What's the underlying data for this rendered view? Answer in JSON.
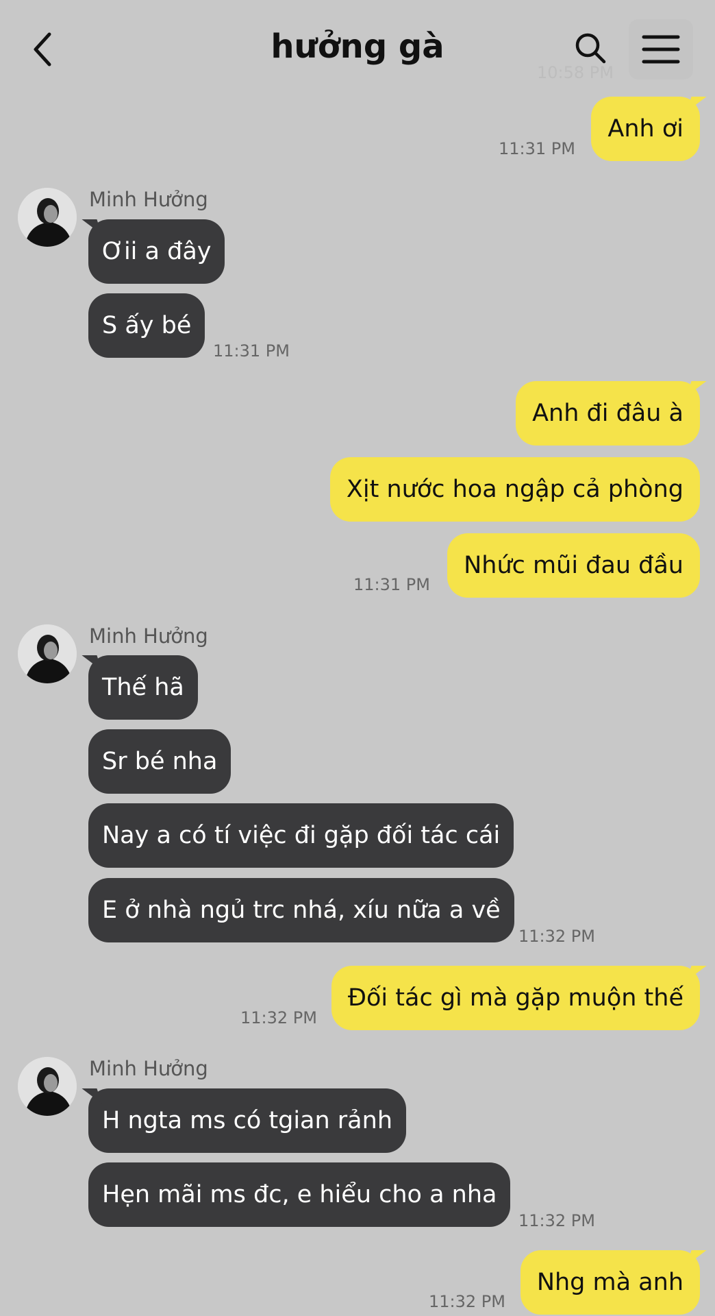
{
  "header": {
    "title": "hưởng gà",
    "ghost_time": "10:58 PM"
  },
  "contact": {
    "name": "Minh Hưởng"
  },
  "messages": [
    {
      "text": "Anh ơi",
      "time": "11:31 PM"
    },
    {
      "sender": "Minh Hưởng",
      "text": "Ơii a đây"
    },
    {
      "text": "S ấy bé",
      "time": "11:31 PM"
    },
    {
      "text": "Anh đi đâu à"
    },
    {
      "text": "Xịt nước hoa ngập cả phòng"
    },
    {
      "text": "Nhức mũi đau đầu",
      "time": "11:31 PM"
    },
    {
      "sender": "Minh Hưởng",
      "text": "Thế hã"
    },
    {
      "text": "Sr bé nha"
    },
    {
      "text": "Nay a có tí việc đi gặp đối tác cái"
    },
    {
      "text": "E ở nhà ngủ trc nhá, xíu nữa a về",
      "time": "11:32 PM"
    },
    {
      "text": "Đối tác gì mà gặp muộn thế",
      "time": "11:32 PM"
    },
    {
      "sender": "Minh Hưởng",
      "text": "H ngta ms có tgian rảnh"
    },
    {
      "text": "Hẹn mãi ms đc, e hiểu cho a nha",
      "time": "11:32 PM"
    },
    {
      "text": "Nhg mà anh",
      "time": "11:32 PM"
    }
  ],
  "colors": {
    "background": "#c8c8c8",
    "my_bubble": "#f5e34a",
    "their_bubble": "#3a3a3c"
  },
  "icons": {
    "back": "chevron-left-icon",
    "search": "search-icon",
    "menu": "hamburger-menu-icon"
  }
}
